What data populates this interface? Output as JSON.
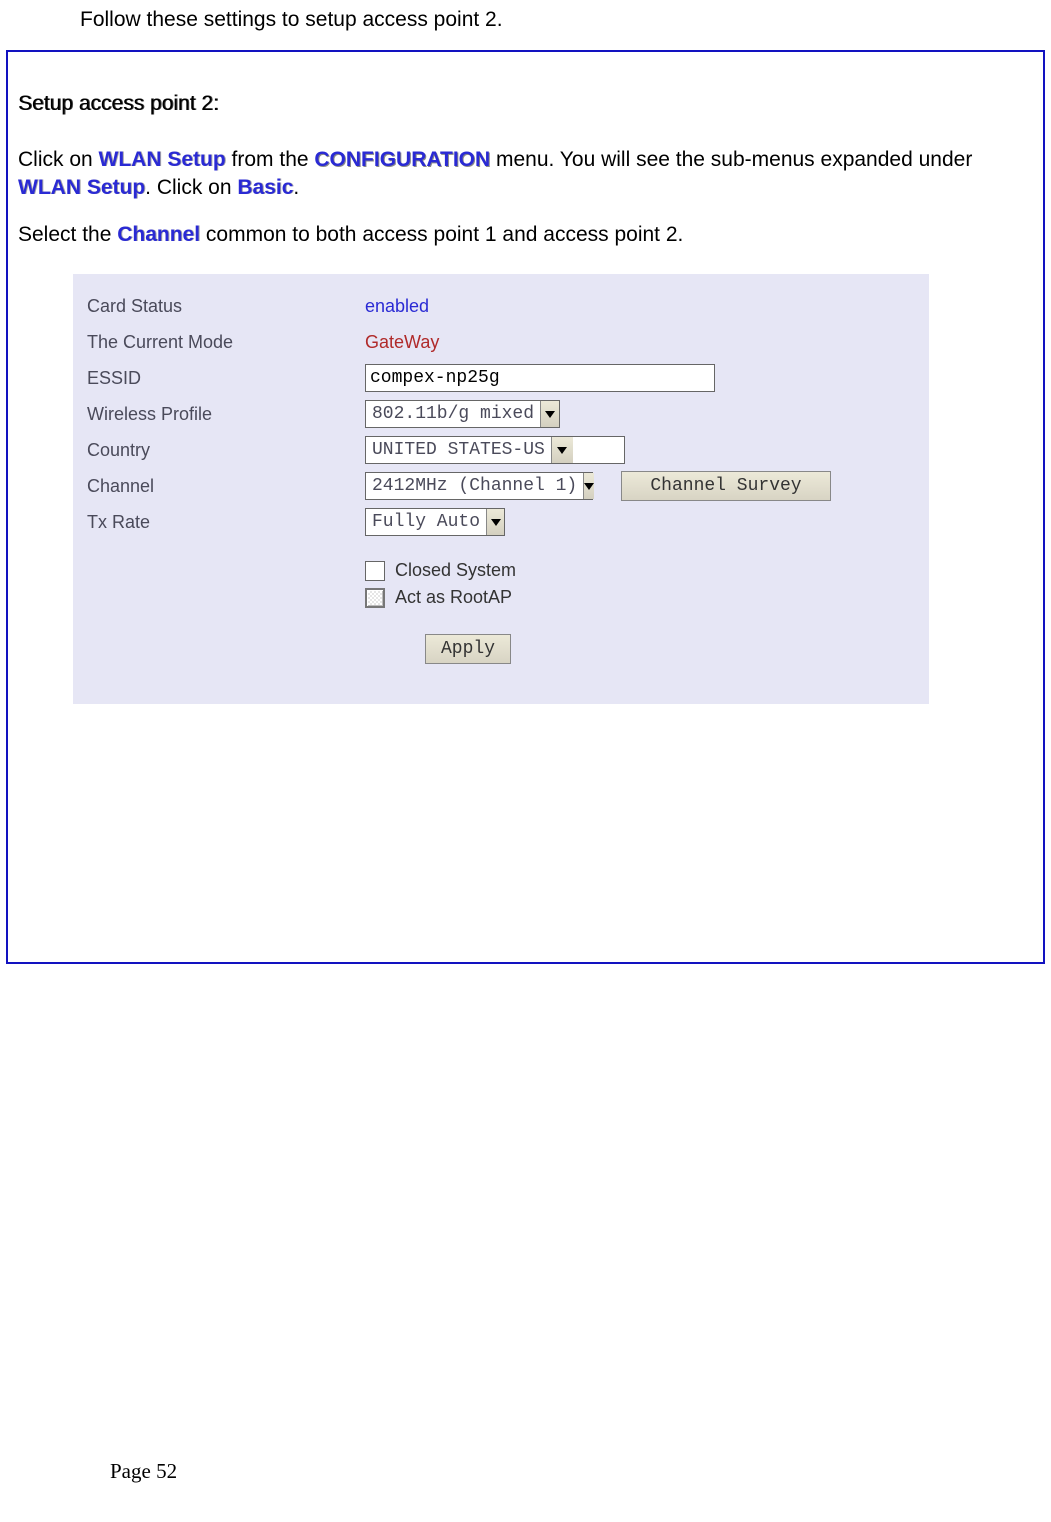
{
  "topline": "Follow these settings to setup access point 2.",
  "heading": "Setup access point 2:",
  "para1": {
    "prefix": "Click on ",
    "kw1": "WLAN Setup",
    "mid1": " from the ",
    "kw2": "CONFIGURATION",
    "mid2": " menu. You will see the sub-menus expanded under ",
    "kw3": "WLAN Setup",
    "mid3": ". Click on ",
    "kw4": "Basic",
    "suffix": "."
  },
  "para2": {
    "prefix": "Select the ",
    "kw": "Channel",
    "suffix": " common to both access point 1 and access point 2."
  },
  "panel": {
    "labels": {
      "card_status": "Card Status",
      "current_mode": "The Current Mode",
      "essid": "ESSID",
      "profile": "Wireless Profile",
      "country": "Country",
      "channel": "Channel",
      "txrate": "Tx Rate"
    },
    "values": {
      "card_status": "enabled",
      "current_mode": "GateWay",
      "essid": "compex-np25g",
      "profile": "802.11b/g mixed",
      "country": "UNITED STATES-US",
      "channel": "2412MHz (Channel 1)",
      "txrate": "Fully Auto"
    },
    "buttons": {
      "channel_survey": "Channel Survey",
      "apply": "Apply"
    },
    "checkboxes": {
      "closed_system": "Closed System",
      "root_ap": "Act as RootAP"
    }
  },
  "page": "Page 52"
}
